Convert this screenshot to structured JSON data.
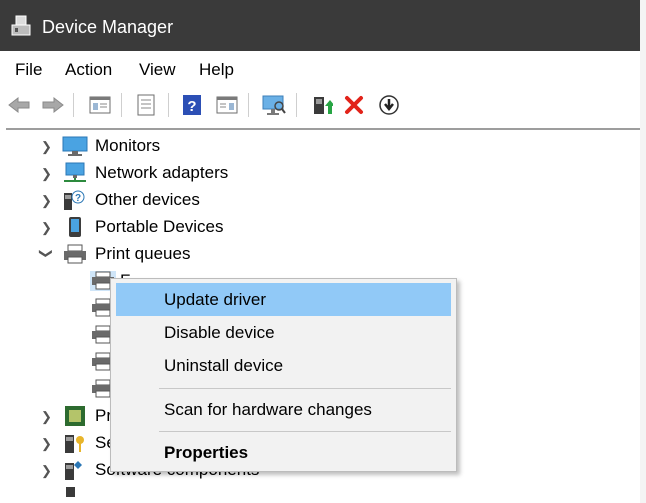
{
  "window": {
    "title": "Device Manager"
  },
  "menu": [
    "File",
    "Action",
    "View",
    "Help"
  ],
  "toolbar": [
    "back-arrow-icon",
    "forward-arrow-icon",
    "properties-sheet-icon",
    "window-icon",
    "help-icon",
    "console-tree-icon",
    "scan-monitor-icon",
    "update-driver-icon",
    "remove-device-icon",
    "install-download-icon"
  ],
  "tree": {
    "items": [
      {
        "label": "Monitors",
        "icon": "monitor-icon"
      },
      {
        "label": "Network adapters",
        "icon": "network-adapter-icon"
      },
      {
        "label": "Other devices",
        "icon": "unknown-device-icon"
      },
      {
        "label": "Portable Devices",
        "icon": "portable-device-icon"
      },
      {
        "label": "Print queues",
        "icon": "printer-icon"
      },
      {
        "label": "Pr",
        "icon": "processor-icon"
      },
      {
        "label": "Se",
        "icon": "security-device-icon"
      },
      {
        "label": "Software components",
        "icon": "software-component-icon"
      }
    ],
    "partial_child_label": "F"
  },
  "context_menu": {
    "items": [
      {
        "label": "Update driver"
      },
      {
        "label": "Disable device"
      },
      {
        "label": "Uninstall device"
      },
      {
        "label": "Scan for hardware changes"
      },
      {
        "label": "Properties"
      }
    ]
  }
}
